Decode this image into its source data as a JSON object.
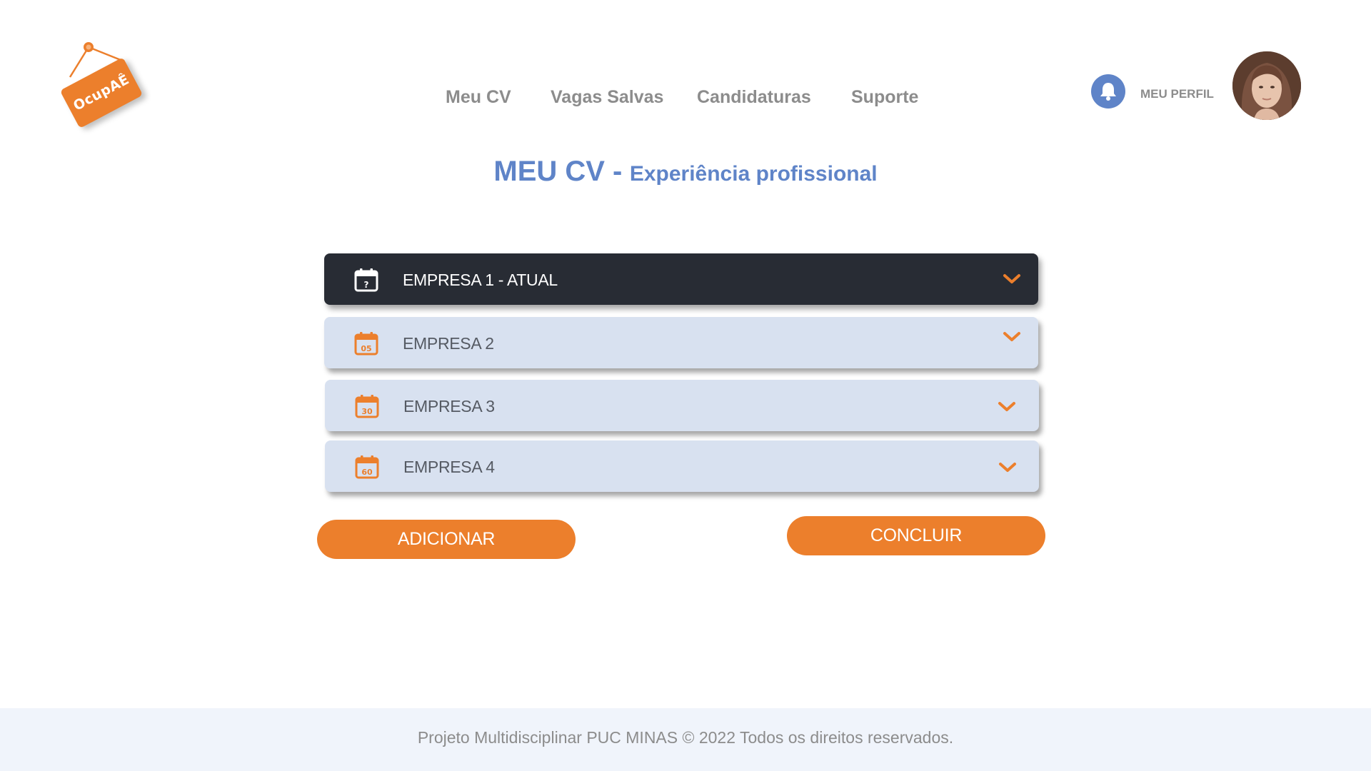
{
  "brand": {
    "logo_text": "OcupAÊ",
    "accent_color": "#ec7f2c",
    "primary_color": "#5f84c8"
  },
  "nav": {
    "items": [
      {
        "label": "Meu CV"
      },
      {
        "label": "Vagas Salvas"
      },
      {
        "label": "Candidaturas"
      },
      {
        "label": "Suporte"
      }
    ]
  },
  "header": {
    "notification_icon": "bell-icon",
    "profile_label": "MEU PERFIL"
  },
  "title": {
    "main": "MEU CV -",
    "sub": "Experiência profissional"
  },
  "experiences": [
    {
      "label": "EMPRESA 1 - ATUAL",
      "icon_text": "?",
      "active": true
    },
    {
      "label": "EMPRESA 2",
      "icon_text": "05",
      "active": false
    },
    {
      "label": "EMPRESA 3",
      "icon_text": "30",
      "active": false
    },
    {
      "label": "EMPRESA 4",
      "icon_text": "60",
      "active": false
    }
  ],
  "actions": {
    "add_label": "ADICIONAR",
    "finish_label": "CONCLUIR"
  },
  "footer": {
    "text": "Projeto Multidisciplinar  PUC MINAS © 2022 Todos os direitos reservados."
  }
}
